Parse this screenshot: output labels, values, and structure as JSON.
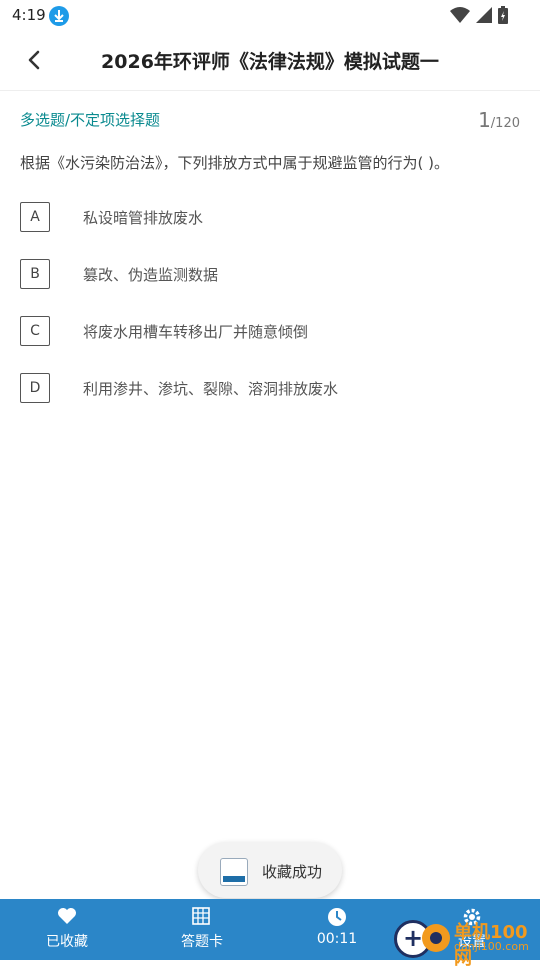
{
  "status": {
    "time": "4:19"
  },
  "header": {
    "title": "2026年环评师《法律法规》模拟试题一"
  },
  "question": {
    "type": "多选题/不定项选择题",
    "current": "1",
    "total": "/120",
    "text": "根据《水污染防治法》，下列排放方式中属于规避监管的行为(    )。",
    "options": [
      {
        "letter": "A",
        "text": "私设暗管排放废水"
      },
      {
        "letter": "B",
        "text": "篡改、伪造监测数据"
      },
      {
        "letter": "C",
        "text": "将废水用槽车转移出厂并随意倾倒"
      },
      {
        "letter": "D",
        "text": "利用渗井、渗坑、裂隙、溶洞排放废水"
      }
    ]
  },
  "toast": {
    "text": "收藏成功"
  },
  "bottom_tabs": {
    "favorites": "已收藏",
    "answer_card": "答题卡",
    "timer": "00:11",
    "settings": "设置"
  },
  "watermark": {
    "text": "单机100网",
    "sub": "danji100.com"
  },
  "colors": {
    "accent": "#2b86c8",
    "type_label": "#0a8a8f"
  }
}
